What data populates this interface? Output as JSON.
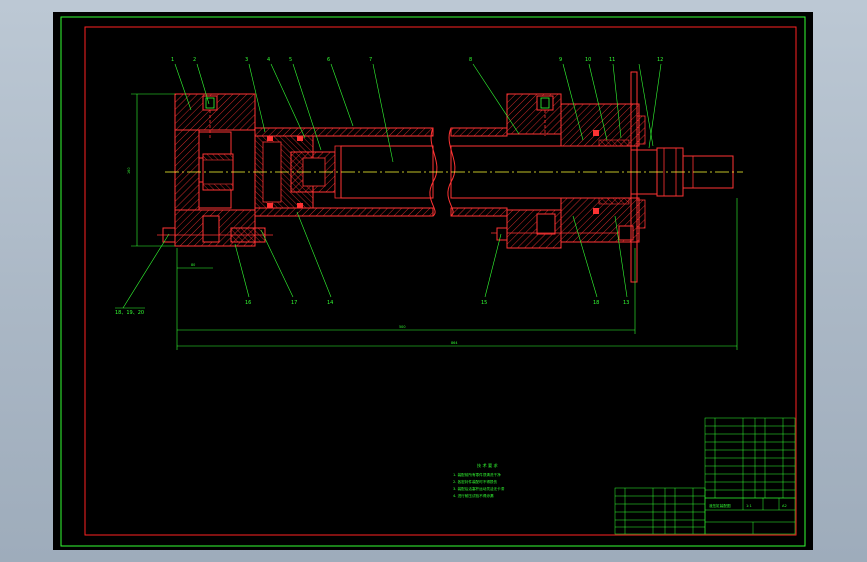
{
  "balloons": {
    "b1": "1",
    "b2": "2",
    "b3": "3",
    "b4": "4",
    "b5": "5",
    "b6": "6",
    "b7": "7",
    "b8": "8",
    "b9": "9",
    "b10": "10",
    "b11": "11",
    "b12": "12",
    "b13": "13",
    "b14": "14",
    "b15": "15",
    "b16": "16",
    "b17": "17",
    "b18": "18",
    "b19": "19",
    "b20": "20",
    "b21": "18、19、20"
  },
  "dims": {
    "height": "160",
    "stroke": "500",
    "total": "864",
    "flange": "80"
  },
  "notes": {
    "title": "技 术 要 求",
    "line1": "1. 装配前所有零件须清洗干净",
    "line2": "2. 各密封件装配时不得损伤",
    "line3": "3. 装配后活塞杆运动灵活无卡滞",
    "line4": "4. 进行耐压试验不得渗漏"
  },
  "title_block": {
    "name": "液压缸装配图",
    "scale": "1:1",
    "sheet": "A2"
  }
}
